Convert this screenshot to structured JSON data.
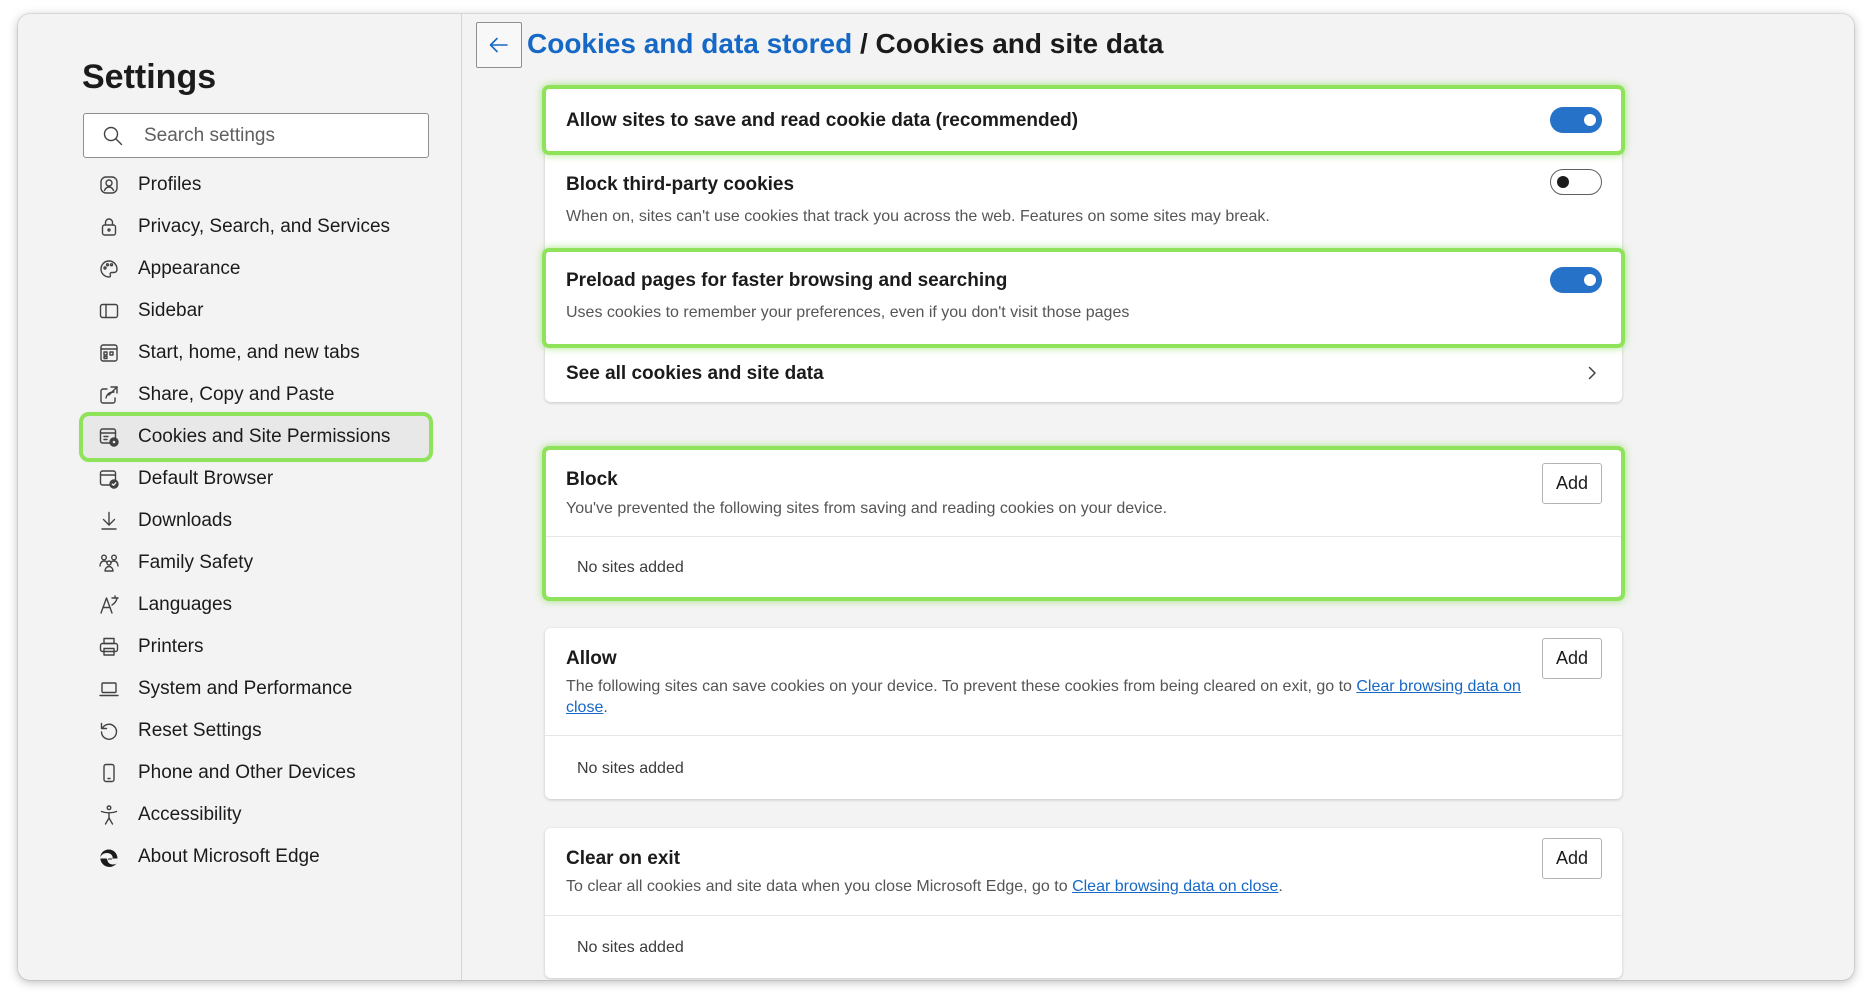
{
  "sidebar": {
    "title": "Settings",
    "search_placeholder": "Search settings",
    "items": [
      {
        "label": "Profiles",
        "icon": "profile-icon"
      },
      {
        "label": "Privacy, Search, and Services",
        "icon": "lock-icon"
      },
      {
        "label": "Appearance",
        "icon": "palette-icon"
      },
      {
        "label": "Sidebar",
        "icon": "sidebar-icon"
      },
      {
        "label": "Start, home, and new tabs",
        "icon": "start-page-icon"
      },
      {
        "label": "Share, Copy and Paste",
        "icon": "share-icon"
      },
      {
        "label": "Cookies and Site Permissions",
        "icon": "cookie-permissions-icon",
        "active": true
      },
      {
        "label": "Default Browser",
        "icon": "default-browser-icon"
      },
      {
        "label": "Downloads",
        "icon": "download-icon"
      },
      {
        "label": "Family Safety",
        "icon": "family-icon"
      },
      {
        "label": "Languages",
        "icon": "language-icon"
      },
      {
        "label": "Printers",
        "icon": "printer-icon"
      },
      {
        "label": "System and Performance",
        "icon": "laptop-icon"
      },
      {
        "label": "Reset Settings",
        "icon": "reset-icon"
      },
      {
        "label": "Phone and Other Devices",
        "icon": "phone-icon"
      },
      {
        "label": "Accessibility",
        "icon": "accessibility-icon"
      },
      {
        "label": "About Microsoft Edge",
        "icon": "edge-logo-icon"
      }
    ]
  },
  "header": {
    "back_icon": "arrow-left-icon",
    "breadcrumb_parent": "Cookies and data stored",
    "breadcrumb_separator": "/",
    "breadcrumb_current": "Cookies and site data"
  },
  "settings_card": {
    "allow_cookies": {
      "title": "Allow sites to save and read cookie data (recommended)",
      "enabled": true
    },
    "block_third_party": {
      "title": "Block third-party cookies",
      "description": "When on, sites can't use cookies that track you across the web. Features on some sites may break.",
      "enabled": false
    },
    "preload_pages": {
      "title": "Preload pages for faster browsing and searching",
      "description": "Uses cookies to remember your preferences, even if you don't visit those pages",
      "enabled": true
    },
    "see_all": {
      "title": "See all cookies and site data",
      "icon": "chevron-right-icon"
    }
  },
  "block_section": {
    "title": "Block",
    "description": "You've prevented the following sites from saving and reading cookies on your device.",
    "add_label": "Add",
    "empty_text": "No sites added"
  },
  "allow_section": {
    "title": "Allow",
    "description_prefix": "The following sites can save cookies on your device. To prevent these cookies from being cleared on exit, go to ",
    "link_text": "Clear browsing data on close",
    "description_suffix": ".",
    "add_label": "Add",
    "empty_text": "No sites added"
  },
  "clear_on_exit_section": {
    "title": "Clear on exit",
    "description_prefix": "To clear all cookies and site data when you close Microsoft Edge, go to ",
    "link_text": "Clear browsing data on close",
    "description_suffix": ".",
    "add_label": "Add",
    "empty_text": "No sites added"
  },
  "colors": {
    "accent": "#2772c9",
    "link": "#1668c6",
    "highlight": "#8fe35a"
  }
}
